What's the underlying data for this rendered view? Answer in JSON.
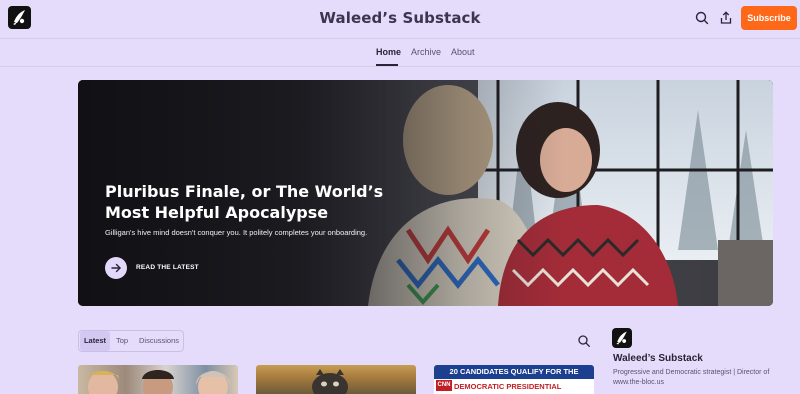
{
  "header": {
    "site_title": "Waleed’s Substack",
    "subscribe_label": "Subscribe",
    "icons": [
      "search-icon",
      "share-icon"
    ]
  },
  "nav": {
    "items": [
      {
        "label": "Home",
        "active": true
      },
      {
        "label": "Archive",
        "active": false
      },
      {
        "label": "About",
        "active": false
      }
    ]
  },
  "hero": {
    "title": "Pluribus Finale, or The World’s Most Helpful Apocalypse",
    "subtitle": "Gilligan's hive mind doesn't conquer you. It politely completes your onboarding.",
    "cta_label": "READ THE LATEST",
    "cta_icon": "arrow-right-icon"
  },
  "feed": {
    "tabs": [
      {
        "label": "Latest",
        "active": true
      },
      {
        "label": "Top",
        "active": false
      },
      {
        "label": "Discussions",
        "active": false
      }
    ]
  },
  "sidebar": {
    "title": "Waleed’s Substack",
    "description": "Progressive and Democratic strategist | Director of www.the-bloc.us"
  },
  "cards": [
    {
      "image": "portraits of three people"
    },
    {
      "image": "illustration of an animal"
    },
    {
      "banner_top": "20 CANDIDATES QUALIFY FOR THE",
      "banner_bottom": "DEMOCRATIC PRESIDENTIAL DEBATES",
      "network": "CNN"
    }
  ],
  "colors": {
    "background": "#e5dcfb",
    "accent": "#ff6719",
    "text": "#2a2437"
  }
}
